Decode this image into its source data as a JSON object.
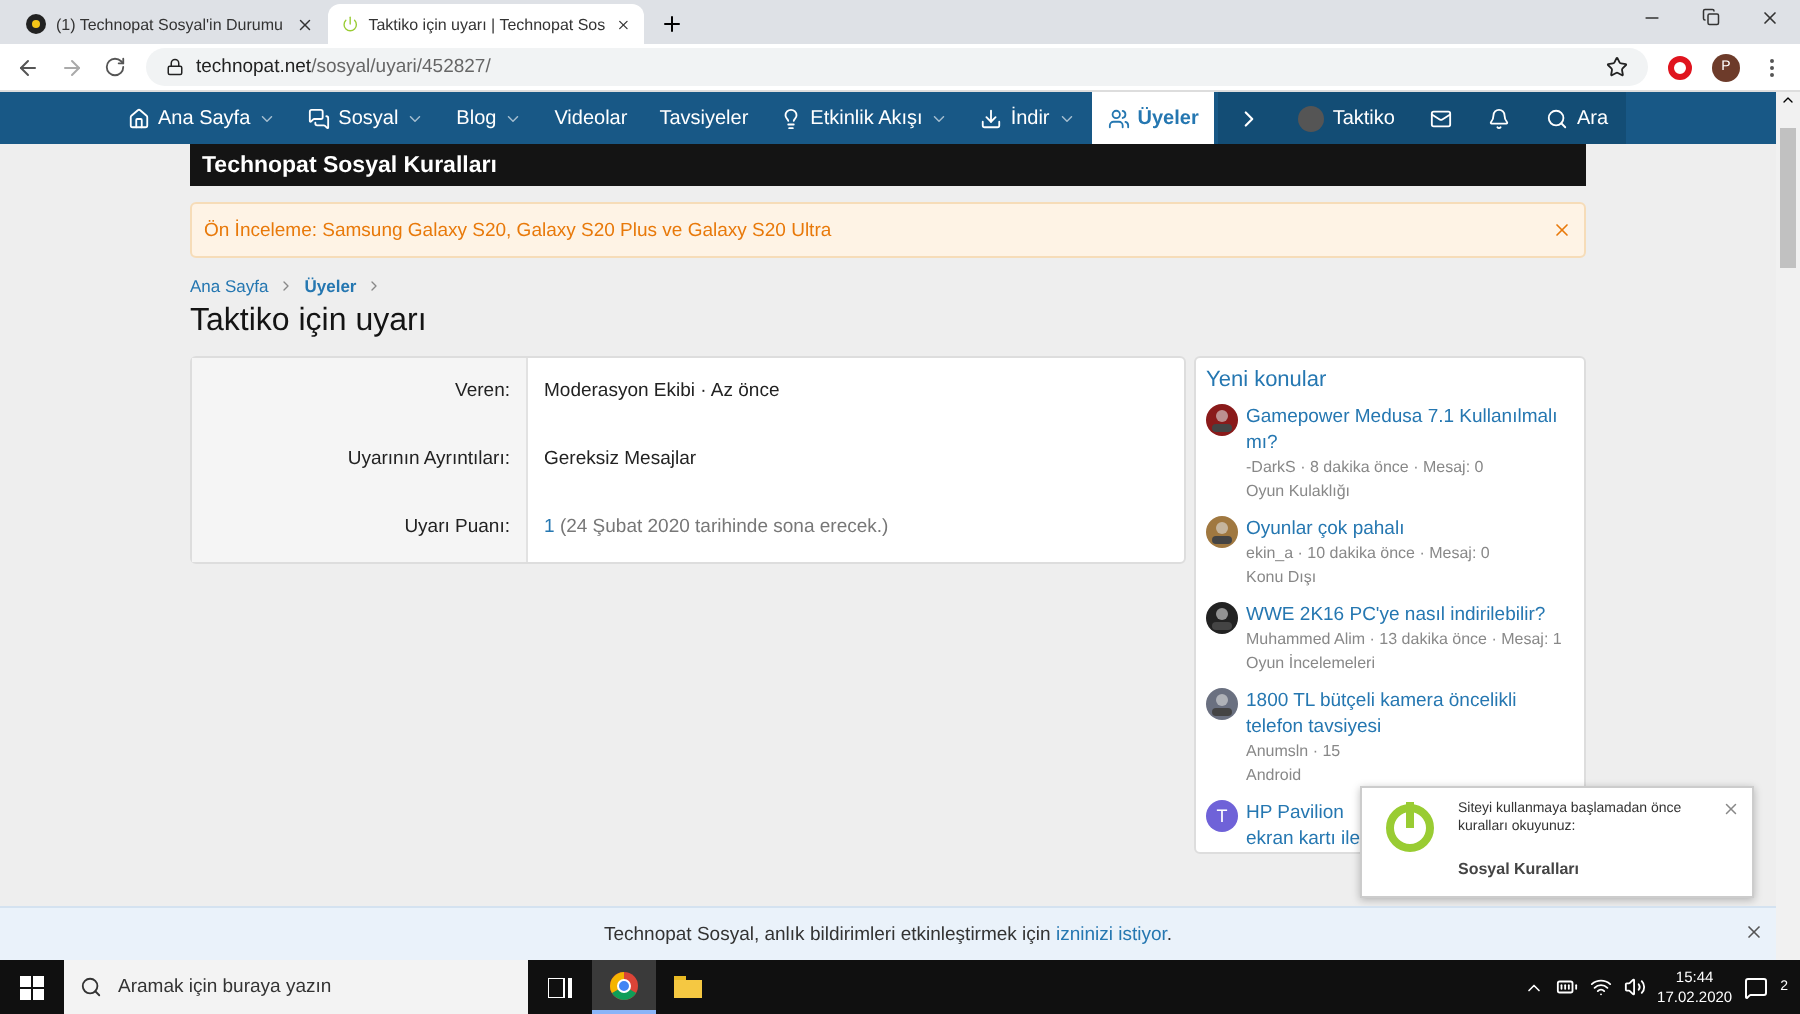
{
  "browser": {
    "tabs": [
      {
        "title": "(1) Technopat Sosyal'in Durumu",
        "selected": false
      },
      {
        "title": "Taktiko için uyarı | Technopat Sos",
        "selected": true
      }
    ],
    "url_host": "technopat.net",
    "url_path": "/sosyal/uyari/452827/",
    "profile_initial": "P"
  },
  "nav": {
    "items": [
      {
        "label": "Ana Sayfa",
        "dropdown": true,
        "selected": false
      },
      {
        "label": "Sosyal",
        "dropdown": true,
        "selected": false
      },
      {
        "label": "Blog",
        "dropdown": true,
        "selected": false
      },
      {
        "label": "Videolar",
        "dropdown": false,
        "selected": false
      },
      {
        "label": "Tavsiyeler",
        "dropdown": false,
        "selected": false
      },
      {
        "label": "Etkinlik Akışı",
        "dropdown": true,
        "selected": false
      },
      {
        "label": "İndir",
        "dropdown": true,
        "selected": false
      },
      {
        "label": "Üyeler",
        "dropdown": false,
        "selected": true
      }
    ],
    "user": "Taktiko",
    "search": "Ara"
  },
  "banner": "Technopat Sosyal Kuralları",
  "notice": "Ön İnceleme: Samsung Galaxy S20, Galaxy S20 Plus ve Galaxy S20 Ultra",
  "breadcrumb": [
    {
      "label": "Ana Sayfa",
      "current": false
    },
    {
      "label": "Üyeler",
      "current": true
    }
  ],
  "title": "Taktiko için uyarı",
  "details": [
    {
      "label": "Veren:",
      "value": "Moderasyon Ekibi · Az önce"
    },
    {
      "label": "Uyarının Ayrıntıları:",
      "value": "Gereksiz Mesajlar"
    },
    {
      "label": "Uyarı Puanı:",
      "value": "1",
      "note": "(24 Şubat 2020 tarihinde sona erecek.)"
    }
  ],
  "sidebar": {
    "title": "Yeni konular",
    "threads": [
      {
        "title": "Gamepower Medusa 7.1 Kullanılmalı mı?",
        "meta": "-DarkS · 8 dakika önce · Mesaj: 0",
        "forum": "Oyun Kulaklığı"
      },
      {
        "title": "Oyunlar çok pahalı",
        "meta": "ekin_a · 10 dakika önce · Mesaj: 0",
        "forum": "Konu Dışı"
      },
      {
        "title": "WWE 2K16 PC'ye nasıl indirilebilir?",
        "meta": "Muhammed Alim · 13 dakika önce · Mesaj: 1",
        "forum": "Oyun İncelemeleri"
      },
      {
        "title": "1800 TL bütçeli kamera öncelikli",
        "title_2": "telefon tavsiyesi",
        "meta": "Anumsln · 15",
        "forum": "Android"
      },
      {
        "title": "HP Pavilion",
        "title_2": "ekran kartı ile",
        "avatar": {
          "kind": "letter",
          "letter": "T",
          "color": "#6f62d8"
        }
      }
    ]
  },
  "toast": {
    "message": "Siteyi kullanmaya başlamadan önce kuralları okuyunuz:",
    "link": "Sosyal Kuralları"
  },
  "push_bar": {
    "text": "Technopat Sosyal, anlık bildirimleri etkinleştirmek için",
    "link": "izninizi istiyor",
    "end": "."
  },
  "taskbar": {
    "search_placeholder": "Aramak için buraya yazın",
    "time": "15:44",
    "date": "17.02.2020",
    "notifications": "2"
  }
}
